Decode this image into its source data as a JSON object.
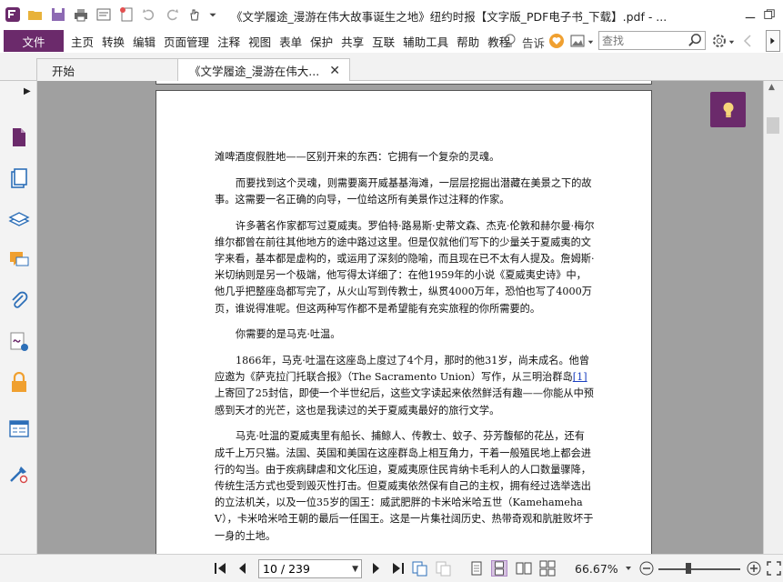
{
  "window": {
    "title": "《文学履途_漫游在伟大故事诞生之地》纽约时报【文字版_PDF电子书_下载】.pdf - ..."
  },
  "menu": {
    "file": "文件",
    "items": [
      "主页",
      "转换",
      "编辑",
      "页面管理",
      "注释",
      "视图",
      "表单",
      "保护",
      "共享",
      "互联",
      "辅助工具",
      "帮助",
      "教程"
    ],
    "tell": "告诉",
    "search_placeholder": "查找"
  },
  "tabs": {
    "start": "开始",
    "doc": "《文学履途_漫游在伟大..."
  },
  "document": {
    "paragraphs": [
      "滩啤酒度假胜地——区别开来的东西：它拥有一个复杂的灵魂。",
      "而要找到这个灵魂，则需要离开威基基海滩，一层层挖掘出潜藏在美景之下的故事。这需要一名正确的向导，一位给这所有美景作过注释的作家。",
      "许多著名作家都写过夏威夷。罗伯特·路易斯·史蒂文森、杰克·伦敦和赫尔曼·梅尔维尔都曾在前往其他地方的途中路过这里。但是仅就他们写下的少量关于夏威夷的文字来看，基本都是虚构的，或运用了深刻的隐喻，而且现在已不太有人提及。詹姆斯·米切纳则是另一个极端，他写得太详细了：在他1959年的小说《夏威夷史诗》中，他几乎把整座岛都写完了，从火山写到传教士，纵贯4000万年，恐怕也写了4000万页，谁说得准呢。但这两种写作都不是希望能有充实旅程的你所需要的。",
      "你需要的是马克·吐温。",
      "1866年，马克·吐温在这座岛上度过了4个月，那时的他31岁，尚未成名。他曾应邀为《萨克拉门托联合报》（The Sacramento Union）写作，从三明治群岛",
      "上寄回了25封信，即使一个半世纪后，这些文字读起来依然鲜活有趣——你能从中预感到天才的光芒，这也是我读过的关于夏威夷最好的旅行文学。",
      "马克·吐温的夏威夷里有船长、捕鲸人、传教士、蚊子、芬芳馥郁的花丛，还有成千上万只猫。法国、英国和美国在这座群岛上相互角力，干着一般殖民地上都会进行的勾当。由于疾病肆虐和文化压迫，夏威夷原住民肯纳卡毛利人的人口数量骤降，传统生活方式也受到毁灭性打击。但夏威夷依然保有自己的主权，拥有经过选举选出的立法机关，以及一位35岁的国王：威武肥胖的卡米哈米哈五世（Kamehameha　V），卡米哈米哈王朝的最后一任国王。这是一片集社阔历史、热带奇观和肮脏败坏于一身的土地。"
    ],
    "footnote_link": "[1]"
  },
  "status": {
    "page_value": "10 / 239",
    "zoom": "66.67%"
  },
  "colors": {
    "accent": "#6b2a6b",
    "workspace": "#a0a0a0"
  }
}
